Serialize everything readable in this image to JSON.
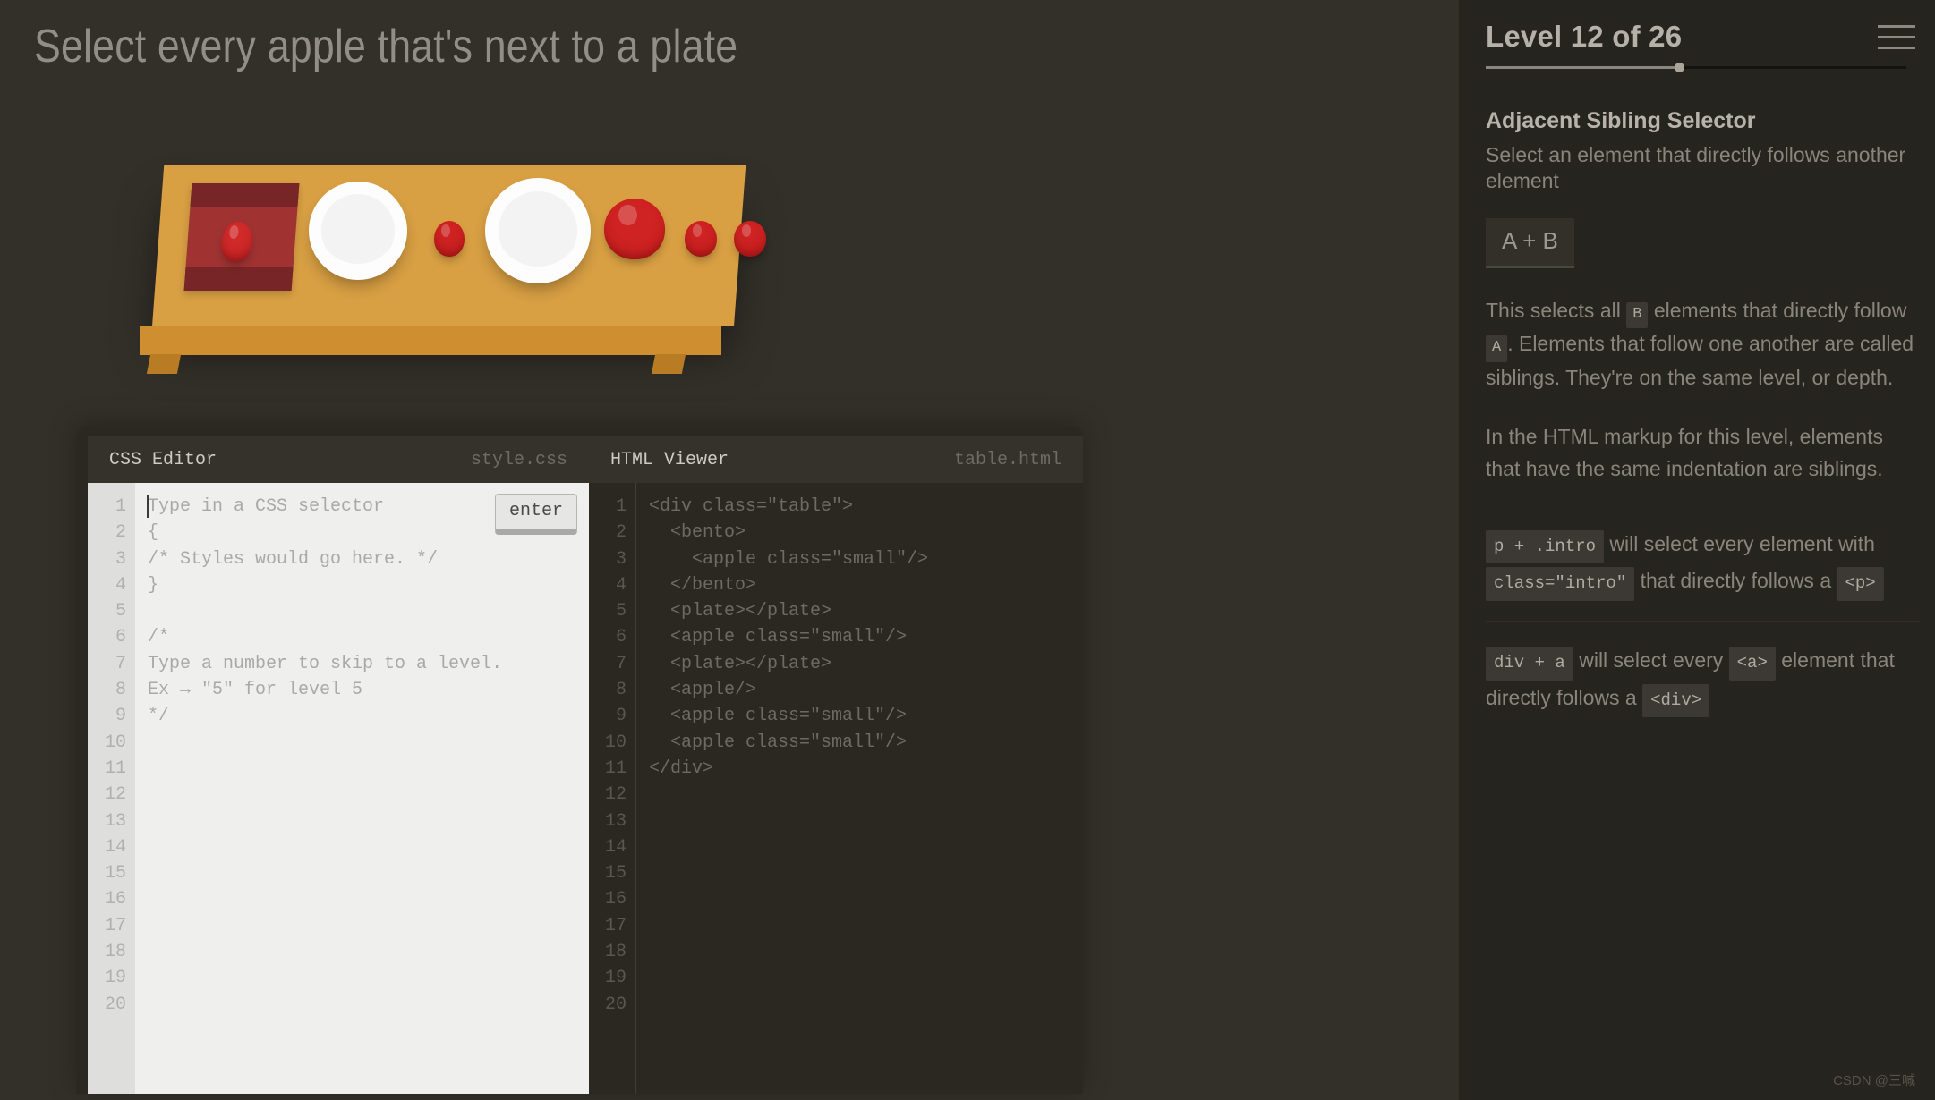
{
  "order": {
    "title": "Select every apple that's next to a plate"
  },
  "board": {
    "items": [
      {
        "type": "bento",
        "contains": "apple-small"
      },
      {
        "type": "plate"
      },
      {
        "type": "apple-small"
      },
      {
        "type": "plate"
      },
      {
        "type": "apple"
      },
      {
        "type": "apple-small"
      },
      {
        "type": "apple-small"
      }
    ],
    "colors": {
      "table_top": "#d89f43",
      "table_edge": "#cf8f30",
      "table_leg": "#b87d24",
      "bento": "#a03232",
      "bento_band": "#772526",
      "apple": "#cf2222",
      "plate": "#fdfdfd"
    }
  },
  "editor": {
    "css_pane": {
      "label": "CSS Editor",
      "file": "style.css",
      "enter_label": "enter",
      "lines": [
        "Type in a CSS selector",
        "{",
        "/* Styles would go here. */",
        "}",
        "",
        "/*",
        "Type a number to skip to a level.",
        "Ex → ″5″ for level 5",
        "*/",
        "",
        "",
        "",
        "",
        "",
        "",
        "",
        "",
        "",
        "",
        ""
      ],
      "line_numbers": [
        1,
        2,
        3,
        4,
        5,
        6,
        7,
        8,
        9,
        10,
        11,
        12,
        13,
        14,
        15,
        16,
        17,
        18,
        19,
        20
      ]
    },
    "html_pane": {
      "label": "HTML Viewer",
      "file": "table.html",
      "lines": [
        "<div class=″table″>",
        "  <bento>",
        "    <apple class=″small″/>",
        "  </bento>",
        "  <plate></plate>",
        "  <apple class=″small″/>",
        "  <plate></plate>",
        "  <apple/>",
        "  <apple class=″small″/>",
        "  <apple class=″small″/>",
        "</div>",
        "",
        "",
        "",
        "",
        "",
        "",
        "",
        "",
        ""
      ],
      "line_numbers": [
        1,
        2,
        3,
        4,
        5,
        6,
        7,
        8,
        9,
        10,
        11,
        12,
        13,
        14,
        15,
        16,
        17,
        18,
        19,
        20
      ]
    }
  },
  "sidebar": {
    "level_label": "Level 12 of 26",
    "level_current": 12,
    "level_total": 26,
    "progress_percent": 46,
    "menu_icon": "hamburger-icon",
    "selector_name": "Adjacent Sibling Selector",
    "selector_desc": "Select an element that directly follows another element",
    "syntax": "A + B",
    "paragraph_1": {
      "part_1": "This selects all",
      "chip_1": "B",
      "part_2": "elements that directly follow",
      "chip_2": "A",
      "part_3": ". Elements that follow one another are called siblings. They're on the same level, or depth."
    },
    "paragraph_2": "In the HTML markup for this level, elements that have the same indentation are siblings.",
    "examples": [
      {
        "chip_1": "p + .intro",
        "text_1": "will select every element with",
        "chip_2": "class=″intro″",
        "text_2": "that directly follows a",
        "chip_3": "<p>"
      },
      {
        "chip_1": "div + a",
        "text_1": "will select every",
        "chip_2": "<a>",
        "text_2": "element that directly follows a",
        "chip_3": "<div>"
      }
    ]
  },
  "watermark": "CSDN @三喊"
}
